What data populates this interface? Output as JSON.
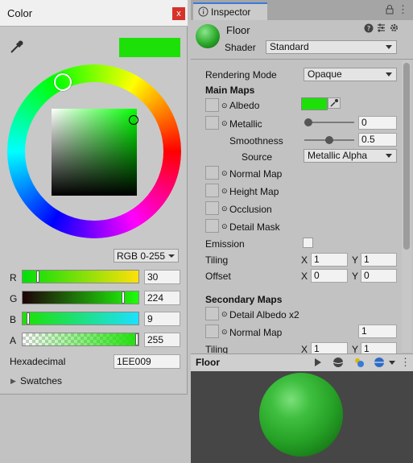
{
  "color_window": {
    "title": "Color",
    "close_glyph": "x",
    "mode": "RGB 0-255",
    "selected_color": "#1EE009",
    "channels": [
      {
        "label": "R",
        "value": "30",
        "fraction": 0.118
      },
      {
        "label": "G",
        "value": "224",
        "fraction": 0.878
      },
      {
        "label": "B",
        "value": "9",
        "fraction": 0.035
      },
      {
        "label": "A",
        "value": "255",
        "fraction": 1.0
      }
    ],
    "hex_label": "Hexadecimal",
    "hex_value": "1EE009",
    "swatches_label": "Swatches"
  },
  "inspector": {
    "tab_label": "Inspector",
    "object_name": "Floor",
    "shader_label": "Shader",
    "shader_value": "Standard",
    "rendering_mode_label": "Rendering Mode",
    "rendering_mode_value": "Opaque",
    "main_maps_header": "Main Maps",
    "albedo_label": "Albedo",
    "albedo_color": "#1EE009",
    "metallic_label": "Metallic",
    "metallic_value": "0",
    "metallic_fraction": 0.0,
    "smoothness_label": "Smoothness",
    "smoothness_value": "0.5",
    "smoothness_fraction": 0.5,
    "source_label": "Source",
    "source_value": "Metallic Alpha",
    "normal_map_label": "Normal Map",
    "height_map_label": "Height Map",
    "occlusion_label": "Occlusion",
    "detail_mask_label": "Detail Mask",
    "emission_label": "Emission",
    "tiling_label": "Tiling",
    "tiling_x": "1",
    "tiling_y": "1",
    "offset_label": "Offset",
    "offset_x": "0",
    "offset_y": "0",
    "x_label": "X",
    "y_label": "Y",
    "secondary_maps_header": "Secondary Maps",
    "detail_albedo_label": "Detail Albedo x2",
    "secondary_normal_map_label": "Normal Map",
    "secondary_normal_value": "1",
    "secondary_tiling_label": "Tiling",
    "secondary_tiling_x": "1",
    "secondary_tiling_y": "1"
  },
  "preview": {
    "title": "Floor"
  },
  "colors": {
    "accent_blue": "#3a79d9",
    "close_red": "#d6322a"
  }
}
